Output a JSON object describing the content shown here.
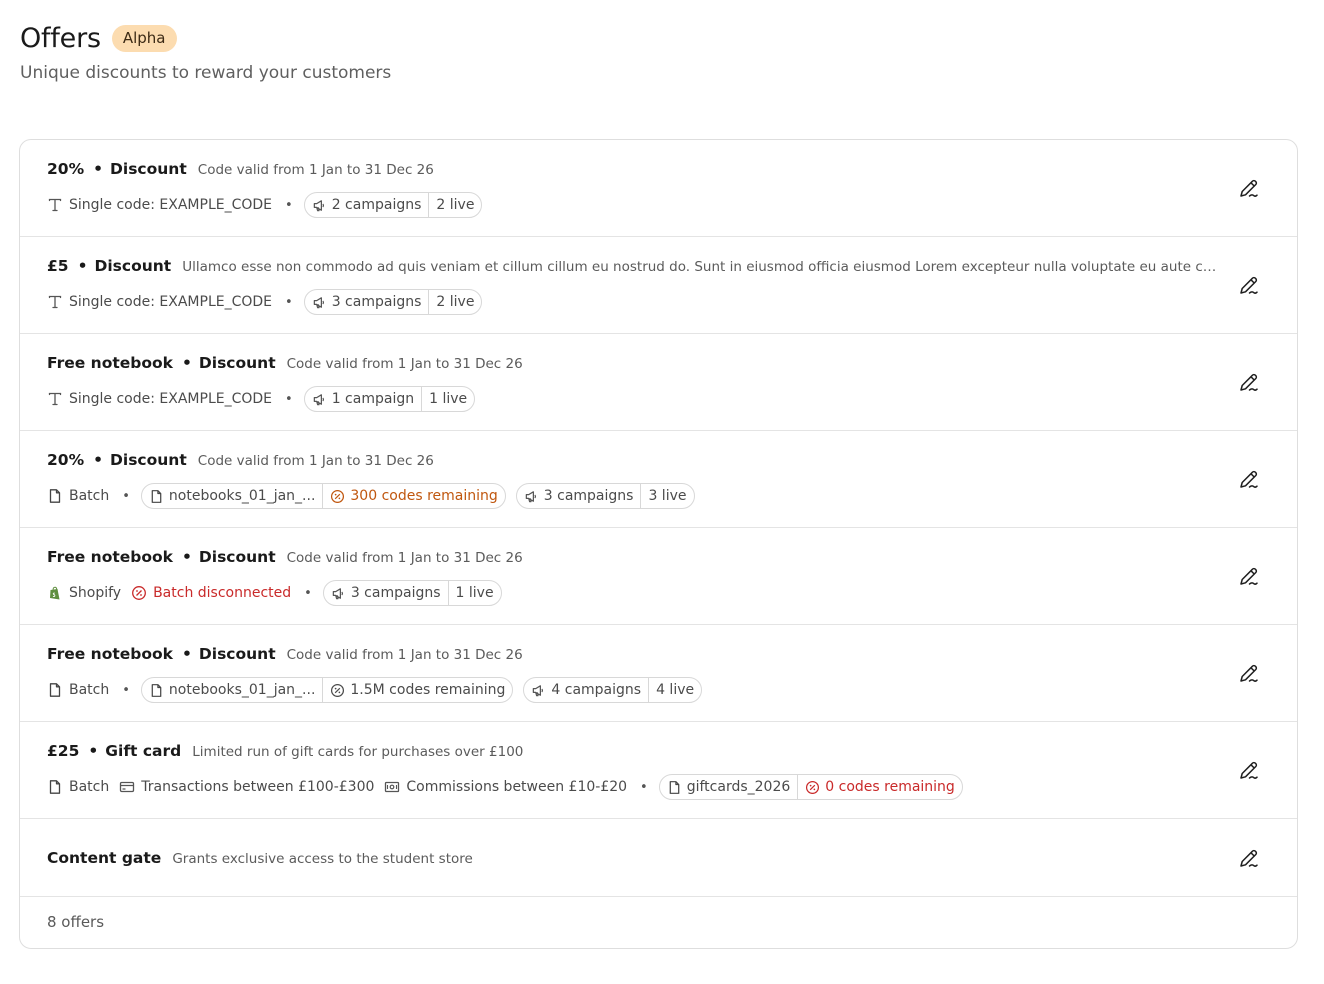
{
  "header": {
    "title": "Offers",
    "badge": "Alpha",
    "subtitle": "Unique discounts to reward your customers"
  },
  "colors": {
    "badge_bg": "#fcdcb0",
    "warning": "#c0570f",
    "error": "#c92a2a",
    "shopify": "#5e8e3e"
  },
  "offers": [
    {
      "value": "20%",
      "type": "Discount",
      "description": "Code valid from 1 Jan to 31 Dec 26",
      "code_label": "Single code: EXAMPLE_CODE",
      "campaigns": "2 campaigns",
      "live": "2 live"
    },
    {
      "value": "£5",
      "type": "Discount",
      "description": "Ullamco esse non commodo ad quis veniam et cillum cillum eu nostrud do. Sunt in eiusmod officia eiusmod Lorem excepteur nulla voluptate eu aute commodo d...",
      "code_label": "Single code: EXAMPLE_CODE",
      "campaigns": "3 campaigns",
      "live": "2 live"
    },
    {
      "value": "Free notebook",
      "type": "Discount",
      "description": "Code valid from 1 Jan to 31 Dec 26",
      "code_label": "Single code: EXAMPLE_CODE",
      "campaigns": "1 campaign",
      "live": "1 live"
    },
    {
      "value": "20%",
      "type": "Discount",
      "description": "Code valid from 1 Jan to 31 Dec 26",
      "source": "Batch",
      "file": "notebooks_01_jan_...",
      "codes": "300 codes remaining",
      "campaigns": "3 campaigns",
      "live": "3 live"
    },
    {
      "value": "Free notebook",
      "type": "Discount",
      "description": "Code valid from 1 Jan to 31 Dec 26",
      "source": "Shopify",
      "status": "Batch disconnected",
      "campaigns": "3 campaigns",
      "live": "1 live"
    },
    {
      "value": "Free notebook",
      "type": "Discount",
      "description": "Code valid from 1 Jan to 31 Dec 26",
      "source": "Batch",
      "file": "notebooks_01_jan_...",
      "codes": "1.5M codes remaining",
      "campaigns": "4 campaigns",
      "live": "4 live"
    },
    {
      "value": "£25",
      "type": "Gift card",
      "description": "Limited run of gift cards for purchases over £100",
      "source": "Batch",
      "transactions": "Transactions between £100-£300",
      "commissions": "Commissions between £10-£20",
      "file": "giftcards_2026",
      "codes": "0 codes remaining"
    },
    {
      "value": "Content gate",
      "description": "Grants exclusive access to the student store"
    }
  ],
  "footer": {
    "count": "8 offers"
  },
  "icons": {
    "text": "text-type-icon",
    "file": "file-icon",
    "megaphone": "megaphone-icon",
    "percent": "percent-badge-icon",
    "card": "credit-card-icon",
    "cash": "banknote-icon",
    "shopify": "shopify-bag-icon",
    "edit": "pen-edit-icon"
  }
}
